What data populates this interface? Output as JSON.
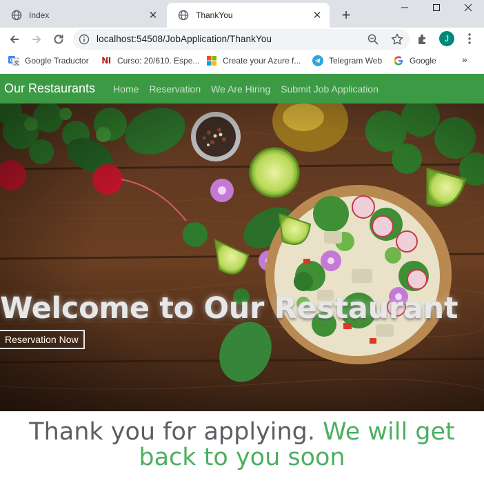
{
  "browser": {
    "tabs": [
      {
        "title": "Index",
        "active": false
      },
      {
        "title": "ThankYou",
        "active": true
      }
    ],
    "url": "localhost:54508/JobApplication/ThankYou",
    "profile_initial": "J",
    "bookmarks": [
      {
        "label": "Google Traductor",
        "icon": "google-translate-icon"
      },
      {
        "label": "Curso: 20/610. Espe...",
        "icon": "ni-logo-icon"
      },
      {
        "label": "Create your Azure f...",
        "icon": "microsoft-logo-icon"
      },
      {
        "label": "Telegram Web",
        "icon": "telegram-icon"
      },
      {
        "label": "Google",
        "icon": "google-icon"
      }
    ],
    "bookmarks_overflow": "»"
  },
  "site": {
    "brand": "Our Restaurants",
    "nav": [
      "Home",
      "Reservation",
      "We Are Hiring",
      "Submit Job Application"
    ],
    "nav_color": "#3c9a45"
  },
  "hero": {
    "title": "Welcome to Our Restaurant",
    "button_label": "Reservation Now"
  },
  "message": {
    "part1": "Thank you for applying.",
    "part2": "We will get back to you soon",
    "color_part1": "#5a5f64",
    "color_part2": "#4caf62"
  }
}
